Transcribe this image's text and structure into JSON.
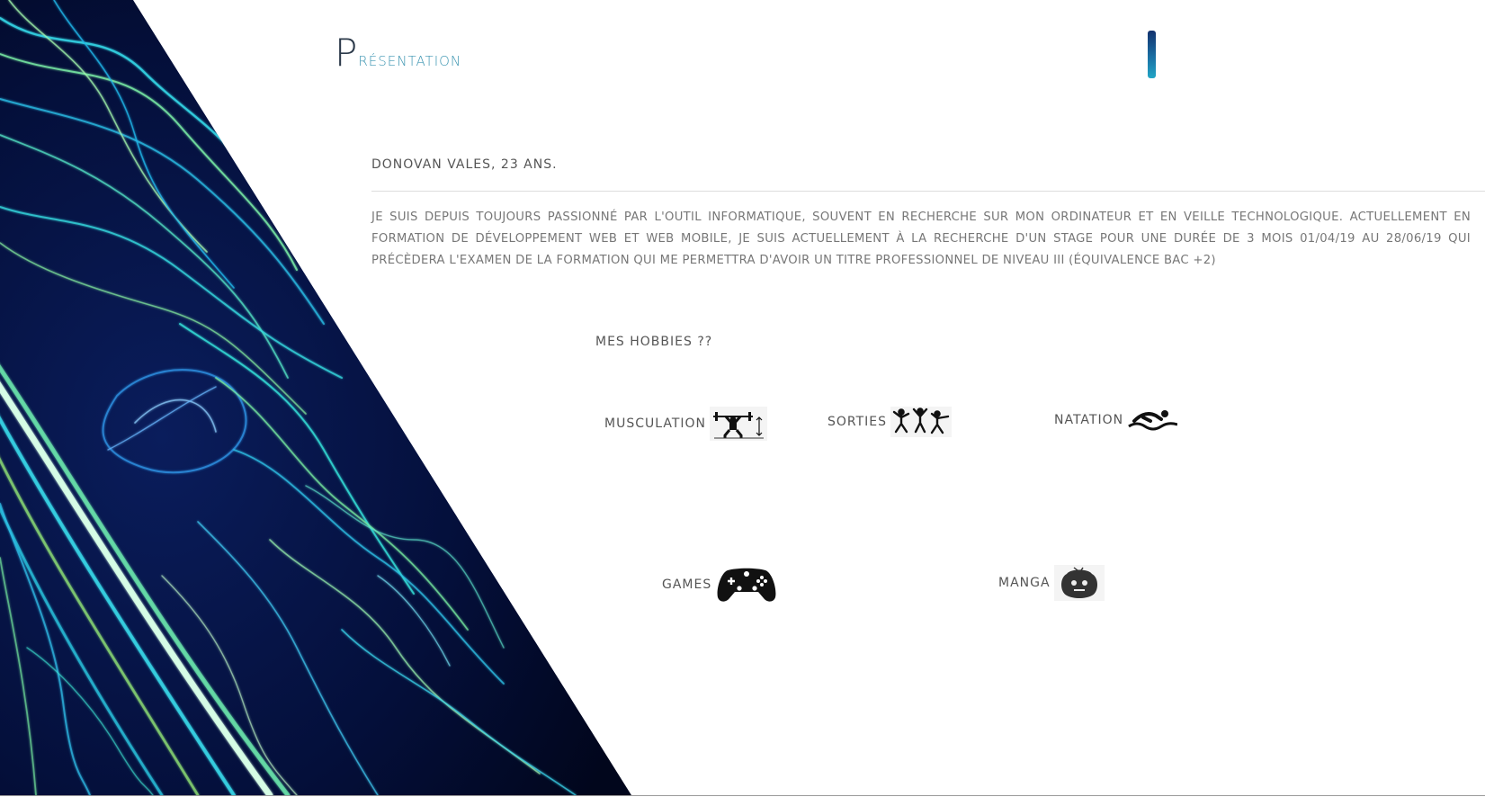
{
  "header": {
    "title_first_letter": "P",
    "title_rest": "résentation"
  },
  "profile": {
    "identity": "Donovan Vales, 23 ans.",
    "bio": "Je suis depuis toujours passionné par l'outil informatique, souvent en recherche sur mon ordinateur et en veille technologique. Actuellement en formation de développement web et web mobile, je suis actuellement à la recherche d'un stage pour une durée de 3 mois 01/04/19 au 28/06/19 qui précèdera l'examen de la formation qui me permettra d'avoir un titre professionnel de niveau III (équivalence BAC +2)"
  },
  "hobbies": {
    "title": "Mes Hobbies ??",
    "items": [
      {
        "label": "Musculation",
        "icon": "weightlifting-icon"
      },
      {
        "label": "Sorties",
        "icon": "dancing-people-icon"
      },
      {
        "label": "Natation",
        "icon": "swimmer-icon"
      },
      {
        "label": "Games",
        "icon": "gamepad-icon"
      },
      {
        "label": "Manga",
        "icon": "manga-icon"
      }
    ]
  },
  "colors": {
    "title_accent": "#3e96b2",
    "text": "#555555",
    "bar_top": "#13326e",
    "bar_bottom": "#22a6c6",
    "art_dark": "#020a28",
    "art_neon_cyan": "#22d8e0",
    "art_neon_green": "#8ef088"
  }
}
